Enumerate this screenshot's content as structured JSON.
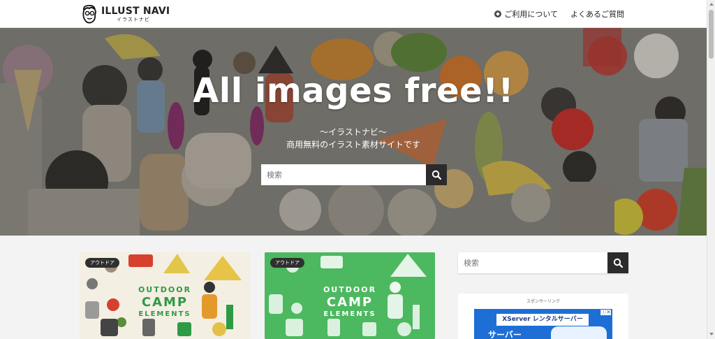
{
  "header": {
    "logo_text": "ILLUST NAVI",
    "logo_sub": "イラストナビ",
    "nav": [
      {
        "label": "ご利用について",
        "icon": "compass-icon"
      },
      {
        "label": "よくあるご質問",
        "icon": ""
      }
    ]
  },
  "hero": {
    "title": "All images free!!",
    "subtitle_1": "〜イラストナビ〜",
    "subtitle_2": "商用無料のイラスト素材サイトです",
    "search_placeholder": "検索",
    "search_icon": "search-icon"
  },
  "cards": [
    {
      "tag": "アウトドア",
      "title_lines": [
        "OUTDOOR",
        "CAMP",
        "ELEMENTS"
      ],
      "bg_color": "#f4efe3",
      "title_color": "#2f9a46"
    },
    {
      "tag": "アウトドア",
      "title_lines": [
        "OUTDOOR",
        "CAMP",
        "ELEMENTS"
      ],
      "bg_color": "#4cb860",
      "title_color": "#ffffff"
    }
  ],
  "sidebar": {
    "search_placeholder": "検索",
    "ad_label": "スポンサーリンク",
    "ad_title": "XServer レンタルサーバー",
    "ad_big": "サーバー",
    "ad_close": "ⓘ✕"
  },
  "colors": {
    "accent_dark": "#2b2b2b",
    "ad_blue": "#1d6fd6"
  }
}
